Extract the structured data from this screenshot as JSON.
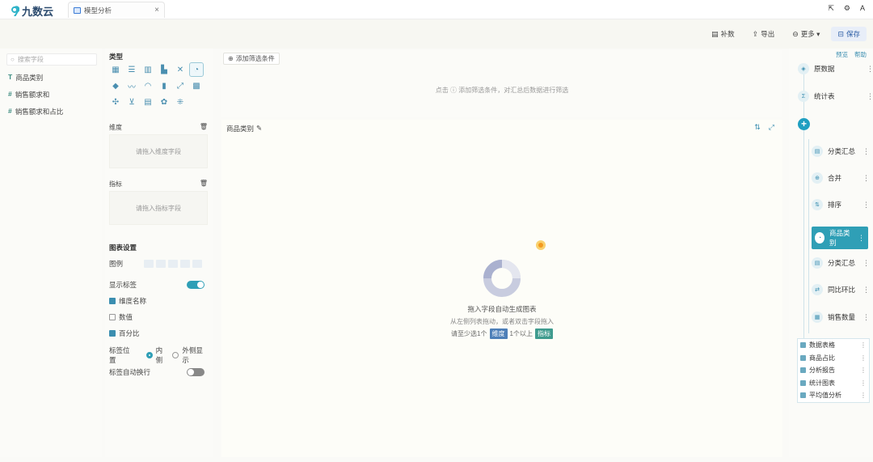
{
  "app": {
    "logo_text": "九数云",
    "tab_title": "模型分析",
    "tab_close": "×",
    "window_controls": [
      "⇱",
      "⚙",
      "A"
    ]
  },
  "toolbar": {
    "buttons": [
      {
        "icon": "▤",
        "label": "补数"
      },
      {
        "icon": "⇪",
        "label": "导出"
      },
      {
        "icon": "⊖",
        "label": "更多 ▾"
      },
      {
        "icon": "⊟",
        "label": "保存"
      }
    ]
  },
  "fields": {
    "search_placeholder": "搜索字段",
    "items": [
      {
        "type": "T",
        "name": "商品类别"
      },
      {
        "type": "#",
        "name": "销售额求和"
      },
      {
        "type": "#",
        "name": "销售额求和占比"
      }
    ]
  },
  "config": {
    "chart_type_title": "类型",
    "chart_types": [
      "▦",
      "☰",
      "▥",
      "▙",
      "✕",
      "◔",
      "◆",
      "〰",
      "◠",
      "▮",
      "⤢",
      "▩",
      "✣",
      "⊻",
      "▤",
      "✿",
      "⁜"
    ],
    "dimension_title": "维度",
    "dimension_placeholder": "请拖入维度字段",
    "measure_title": "指标",
    "measure_placeholder": "请拖入指标字段",
    "chart_settings_title": "图表设置",
    "legend_label": "图例",
    "show_label": "显示标签",
    "opt_dimension": "维度名称",
    "opt_value": "数值",
    "opt_percent": "百分比",
    "label_position_label": "标签位置",
    "pos_inside": "内侧",
    "pos_outside": "外侧显示",
    "auto_rotate_label": "标签自动换行"
  },
  "filter": {
    "add_label": "添加筛选条件",
    "hint": "点击 ⓘ 添加筛选条件，对汇总后数据进行筛选"
  },
  "canvas": {
    "title": "商品类别",
    "empty_title": "拖入字段自动生成图表",
    "empty_sub": "从左侧列表拖动，或者双击字段拖入",
    "empty_line_pre": "请至少选1个",
    "dim_pill": "维度",
    "empty_line_mid": "1个以上",
    "mea_pill": "指标"
  },
  "flow": {
    "top_links": [
      "预览",
      "帮助"
    ],
    "nodes": [
      "原数据",
      "统计表",
      "分类汇总",
      "合并",
      "排序",
      "商品类别",
      "分类汇总",
      "同比环比",
      "销售数量"
    ],
    "outputs": [
      "数据表格",
      "商品占比",
      "分析报告",
      "统计图表",
      "平均值分析"
    ]
  },
  "colors": {
    "accent": "#2f9fb6",
    "dimension": "#4d7fb8",
    "measure": "#3f9b8e"
  }
}
